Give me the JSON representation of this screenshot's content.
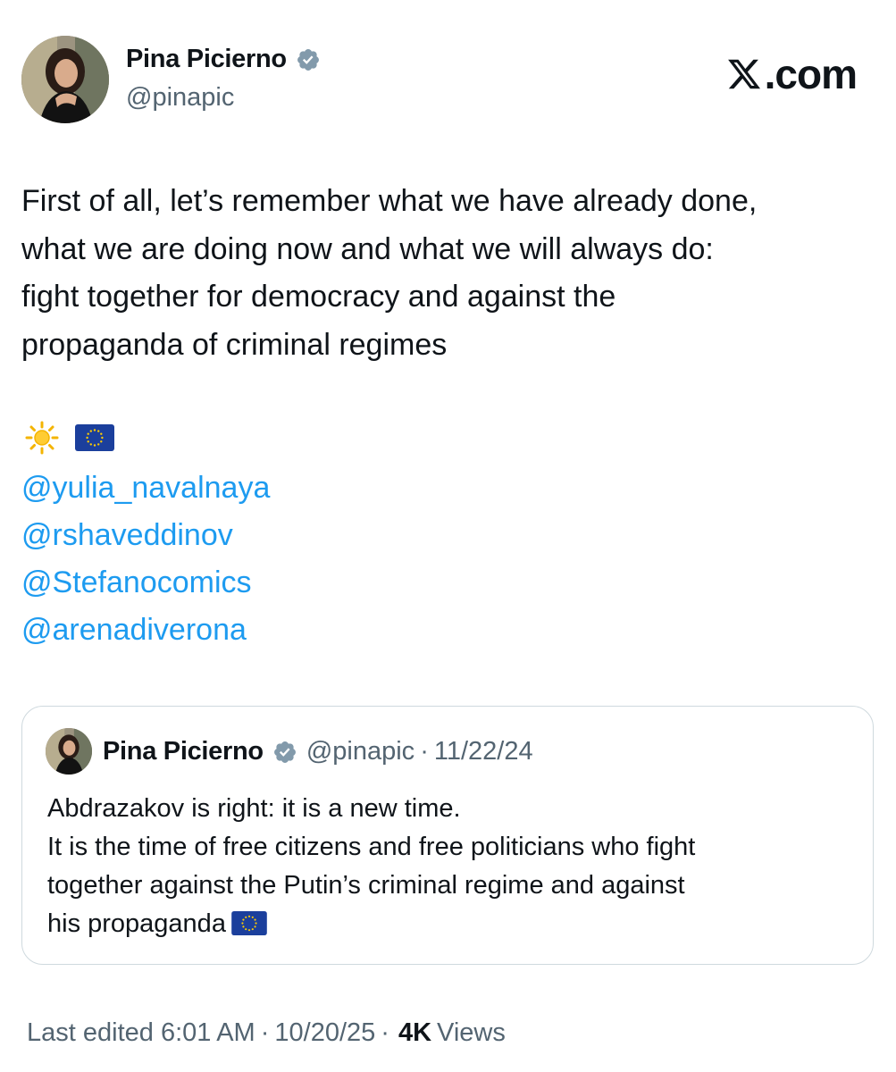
{
  "author": {
    "name": "Pina Picierno",
    "handle": "@pinapic"
  },
  "brand": {
    "label": ".com"
  },
  "tweet": {
    "lines": [
      "First of all, let’s remember what we have already done,",
      "what we are doing now and what we will always do:",
      "fight together for democracy and against the",
      "propaganda of criminal regimes"
    ],
    "emojis": [
      "sun-icon",
      "eu-flag-icon"
    ],
    "mentions": [
      "@yulia_navalnaya",
      "@rshaveddinov",
      "@Stefanocomics",
      "@arenadiverona"
    ]
  },
  "quote": {
    "name": "Pina Picierno",
    "handle": "@pinapic",
    "separator": "·",
    "date": "11/22/24",
    "lines": [
      "Abdrazakov is right: it is a new time.",
      "It is the time of free citizens and free politicians who fight",
      "together against the Putin’s  criminal regime and against",
      "his propaganda"
    ]
  },
  "footer": {
    "edited": "Last edited 6:01 AM",
    "separator": "·",
    "date": "10/20/25",
    "views_count": "4K",
    "views_label": "Views"
  },
  "colors": {
    "link": "#1d9bf0",
    "secondary_text": "#536471",
    "verified": "#829aab",
    "border": "#cfd9de"
  }
}
